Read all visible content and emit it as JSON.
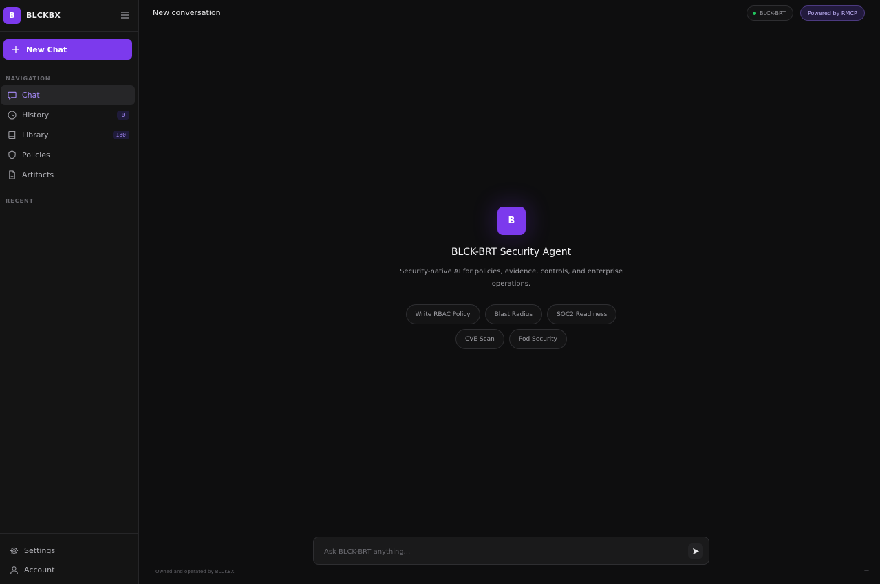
{
  "sidebar": {
    "brand": {
      "logo_letter": "B",
      "name": "BLCKBX"
    },
    "new_chat_label": "New Chat",
    "nav_section_label": "NAVIGATION",
    "recent_section_label": "RECENT",
    "items": [
      {
        "label": "Chat",
        "icon": "chat-bubble-icon",
        "active": true
      },
      {
        "label": "History",
        "icon": "clock-icon",
        "badge": "0"
      },
      {
        "label": "Library",
        "icon": "book-icon",
        "badge": "180"
      },
      {
        "label": "Policies",
        "icon": "shield-icon"
      },
      {
        "label": "Artifacts",
        "icon": "document-icon"
      }
    ],
    "bottom": {
      "settings_label": "Settings",
      "account_label": "Account"
    }
  },
  "header": {
    "title": "New conversation",
    "status_label": "BLCK-BRT",
    "powered_label": "Powered by RMCP"
  },
  "hero": {
    "logo_letter": "B",
    "title": "BLCK-BRT Security Agent",
    "subtitle": "Security-native AI for policies, evidence, controls, and enterprise operations.",
    "suggestions": [
      "Write RBAC Policy",
      "Blast Radius",
      "SOC2 Readiness",
      "CVE Scan",
      "Pod Security"
    ]
  },
  "composer": {
    "placeholder": "Ask BLCK-BRT anything..."
  },
  "footer": {
    "note": "Owned and operated by BLCKBX",
    "right": "—"
  },
  "colors": {
    "accent": "#7c3aed",
    "accent_text": "#a78bfa",
    "background": "#0e0e0f",
    "sidebar": "#141414",
    "status_online": "#22c55e"
  }
}
